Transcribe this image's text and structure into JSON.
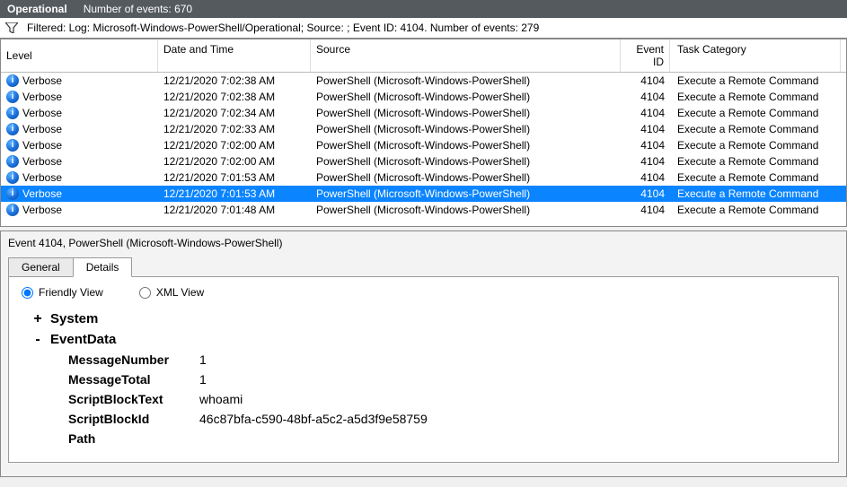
{
  "titlebar": {
    "operational": "Operational",
    "count_label": "Number of events: 670"
  },
  "filter": {
    "text": "Filtered: Log: Microsoft-Windows-PowerShell/Operational; Source: ; Event ID: 4104. Number of events: 279"
  },
  "columns": {
    "level": "Level",
    "date": "Date and Time",
    "source": "Source",
    "id": "Event ID",
    "task": "Task Category"
  },
  "radios": {
    "friendly": "Friendly View",
    "xml": "XML View"
  },
  "events": [
    {
      "level": "Verbose",
      "date": "12/21/2020 7:02:38 AM",
      "source": "PowerShell (Microsoft-Windows-PowerShell)",
      "id": "4104",
      "task": "Execute a Remote Command",
      "selected": false
    },
    {
      "level": "Verbose",
      "date": "12/21/2020 7:02:38 AM",
      "source": "PowerShell (Microsoft-Windows-PowerShell)",
      "id": "4104",
      "task": "Execute a Remote Command",
      "selected": false
    },
    {
      "level": "Verbose",
      "date": "12/21/2020 7:02:34 AM",
      "source": "PowerShell (Microsoft-Windows-PowerShell)",
      "id": "4104",
      "task": "Execute a Remote Command",
      "selected": false
    },
    {
      "level": "Verbose",
      "date": "12/21/2020 7:02:33 AM",
      "source": "PowerShell (Microsoft-Windows-PowerShell)",
      "id": "4104",
      "task": "Execute a Remote Command",
      "selected": false
    },
    {
      "level": "Verbose",
      "date": "12/21/2020 7:02:00 AM",
      "source": "PowerShell (Microsoft-Windows-PowerShell)",
      "id": "4104",
      "task": "Execute a Remote Command",
      "selected": false
    },
    {
      "level": "Verbose",
      "date": "12/21/2020 7:02:00 AM",
      "source": "PowerShell (Microsoft-Windows-PowerShell)",
      "id": "4104",
      "task": "Execute a Remote Command",
      "selected": false
    },
    {
      "level": "Verbose",
      "date": "12/21/2020 7:01:53 AM",
      "source": "PowerShell (Microsoft-Windows-PowerShell)",
      "id": "4104",
      "task": "Execute a Remote Command",
      "selected": false
    },
    {
      "level": "Verbose",
      "date": "12/21/2020 7:01:53 AM",
      "source": "PowerShell (Microsoft-Windows-PowerShell)",
      "id": "4104",
      "task": "Execute a Remote Command",
      "selected": true
    },
    {
      "level": "Verbose",
      "date": "12/21/2020 7:01:48 AM",
      "source": "PowerShell (Microsoft-Windows-PowerShell)",
      "id": "4104",
      "task": "Execute a Remote Command",
      "selected": false
    }
  ],
  "detail": {
    "heading": "Event 4104, PowerShell (Microsoft-Windows-PowerShell)",
    "tabs": {
      "general": "General",
      "details": "Details"
    },
    "tree": {
      "system_label": "System",
      "eventdata_label": "EventData",
      "items": [
        {
          "key": "MessageNumber",
          "value": "1"
        },
        {
          "key": "MessageTotal",
          "value": "1"
        },
        {
          "key": "ScriptBlockText",
          "value": "whoami"
        },
        {
          "key": "ScriptBlockId",
          "value": "46c87bfa-c590-48bf-a5c2-a5d3f9e58759"
        },
        {
          "key": "Path",
          "value": ""
        }
      ]
    }
  }
}
